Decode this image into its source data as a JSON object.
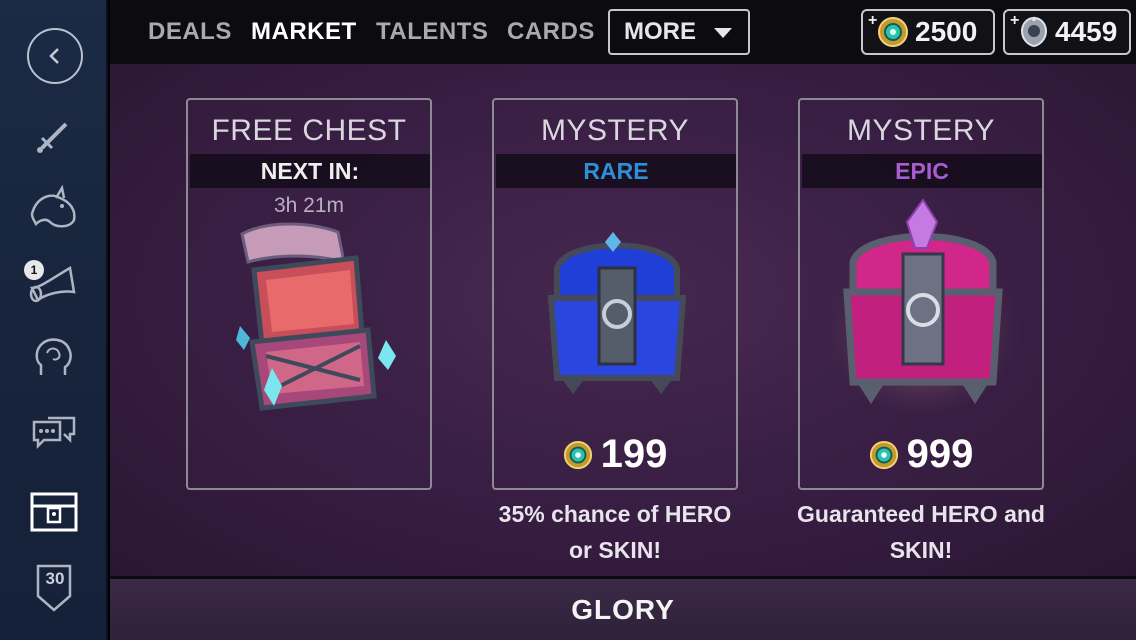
{
  "nav": {
    "tabs": [
      {
        "label": "DEALS"
      },
      {
        "label": "MARKET",
        "active": true
      },
      {
        "label": "TALENTS"
      },
      {
        "label": "CARDS"
      }
    ],
    "more_label": "MORE"
  },
  "currencies": {
    "gold": {
      "plus": "+",
      "value": "2500",
      "icon": "gold-coin-icon"
    },
    "ice": {
      "plus": "+",
      "value": "4459",
      "icon": "ice-icon"
    }
  },
  "sidebar": {
    "icons": [
      "back-icon",
      "sword-icon",
      "dragon-icon",
      "horn-icon",
      "head-icon",
      "chat-icon",
      "chest-icon",
      "level-icon"
    ],
    "horn_badge": "1",
    "level": "30"
  },
  "cards": [
    {
      "title": "FREE CHEST",
      "subtitle": "NEXT IN:",
      "subtitle_color": "#eeeeee",
      "timer": "3h 21m"
    },
    {
      "title": "MYSTERY",
      "subtitle": "RARE",
      "subtitle_color": "#2f8fd6",
      "price": "199",
      "description_line1": "35% chance of HERO",
      "description_line2": "or SKIN!"
    },
    {
      "title": "MYSTERY",
      "subtitle": "EPIC",
      "subtitle_color": "#a85ed0",
      "price": "999",
      "description_line1": "Guaranteed HERO and",
      "description_line2": "SKIN!"
    }
  ],
  "footer": {
    "label": "GLORY"
  },
  "colors": {
    "sidebar": "#1b2a45",
    "topbar": "#0c0c10",
    "main": "#3a1f45",
    "rare": "#2f8fd6",
    "epic": "#a85ed0"
  }
}
